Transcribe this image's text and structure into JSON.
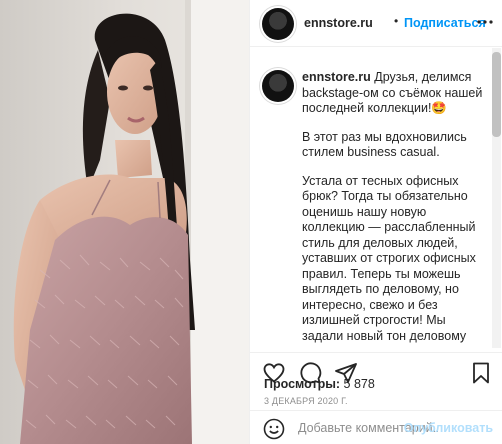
{
  "post": {
    "image_alt": "Девушка в розовом платье с перьями у белой стены"
  },
  "header": {
    "username": "ennstore.ru",
    "separator": "•",
    "follow_label": "Подписаться",
    "more_icon": "more-horizontal-icon"
  },
  "caption": {
    "username": "ennstore.ru",
    "first_line": "Друзья, делимся backstage-ом со съёмок нашей последней коллекции!🤩",
    "p2": "В этот раз мы вдохновились стилем business casual.",
    "p3": "Устала от тесных офисных брюк? Тогда ты обязательно оценишь нашу новую коллекцию — расслабленный стиль для деловых людей, уставших от строгих офисных правил. Теперь ты можешь выглядеть по деловому, но интересно, свежо и без излишней строгости! Мы задали новый тон деловому стилю, дополнив его необычными деталями и кроем."
  },
  "actions": {
    "like_icon": "heart-icon",
    "comment_icon": "comment-icon",
    "share_icon": "share-icon",
    "save_icon": "bookmark-icon"
  },
  "stats": {
    "views_label": "Просмотры:",
    "views_value": "5 878",
    "date": "3 ДЕКАБРЯ 2020 Г."
  },
  "comment": {
    "emoji_icon": "smile-icon",
    "placeholder": "Добавьте комментарий...",
    "publish_label": "Опубликовать"
  },
  "colors": {
    "accent": "#0095f6",
    "publish_disabled": "#b2dffc",
    "text": "#262626",
    "muted": "#8e8e8e",
    "dress": "#b89090"
  }
}
